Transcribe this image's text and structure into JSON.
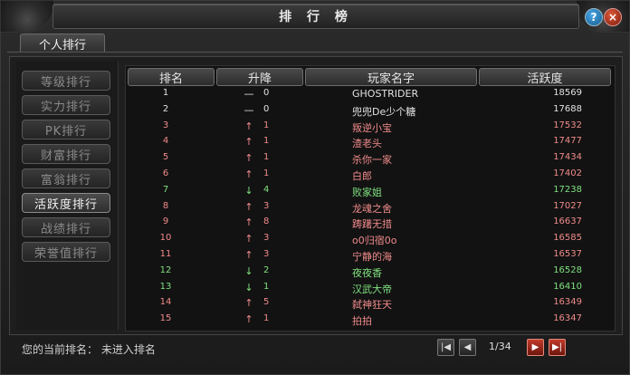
{
  "window": {
    "title": "排 行 榜"
  },
  "controls": {
    "help": "?",
    "close": "×"
  },
  "tab": {
    "label": "个人排行"
  },
  "sidebar": {
    "items": [
      {
        "label": "等级排行",
        "active": false
      },
      {
        "label": "实力排行",
        "active": false
      },
      {
        "label": "PK排行",
        "active": false
      },
      {
        "label": "财富排行",
        "active": false
      },
      {
        "label": "富翁排行",
        "active": false
      },
      {
        "label": "活跃度排行",
        "active": true
      },
      {
        "label": "战绩排行",
        "active": false
      },
      {
        "label": "荣誉值排行",
        "active": false
      }
    ]
  },
  "table": {
    "headers": [
      "排名",
      "升降",
      "玩家名字",
      "活跃度"
    ],
    "rows": [
      {
        "rank": "1",
        "dir": "—",
        "change": "0",
        "name": "GHOSTRIDER",
        "score": "18569",
        "color": "white"
      },
      {
        "rank": "2",
        "dir": "—",
        "change": "0",
        "name": "兜兜De少个糖",
        "score": "17688",
        "color": "white"
      },
      {
        "rank": "3",
        "dir": "↑",
        "change": "1",
        "name": "叛逆小宝",
        "score": "17532",
        "color": "red"
      },
      {
        "rank": "4",
        "dir": "↑",
        "change": "1",
        "name": "渣老头",
        "score": "17477",
        "color": "red"
      },
      {
        "rank": "5",
        "dir": "↑",
        "change": "1",
        "name": "杀你一家",
        "score": "17434",
        "color": "red"
      },
      {
        "rank": "6",
        "dir": "↑",
        "change": "1",
        "name": "白郎",
        "score": "17402",
        "color": "red"
      },
      {
        "rank": "7",
        "dir": "↓",
        "change": "4",
        "name": "败家姐",
        "score": "17238",
        "color": "green"
      },
      {
        "rank": "8",
        "dir": "↑",
        "change": "3",
        "name": "龙魂之舍",
        "score": "17027",
        "color": "red"
      },
      {
        "rank": "9",
        "dir": "↑",
        "change": "8",
        "name": "踌躇无措",
        "score": "16637",
        "color": "red"
      },
      {
        "rank": "10",
        "dir": "↑",
        "change": "3",
        "name": "o0归宿0o",
        "score": "16585",
        "color": "red"
      },
      {
        "rank": "11",
        "dir": "↑",
        "change": "3",
        "name": "宁静的海",
        "score": "16537",
        "color": "red"
      },
      {
        "rank": "12",
        "dir": "↓",
        "change": "2",
        "name": "夜夜香",
        "score": "16528",
        "color": "green"
      },
      {
        "rank": "13",
        "dir": "↓",
        "change": "1",
        "name": "汉武大帝",
        "score": "16410",
        "color": "green"
      },
      {
        "rank": "14",
        "dir": "↑",
        "change": "5",
        "name": "弑神狂天",
        "score": "16349",
        "color": "red"
      },
      {
        "rank": "15",
        "dir": "↑",
        "change": "1",
        "name": "拍拍",
        "score": "16347",
        "color": "red"
      }
    ]
  },
  "footer": {
    "label": "您的当前排名：  未进入排名",
    "page": "1/34",
    "first": "|◀",
    "prev": "◀",
    "next": "▶",
    "last": "▶|"
  },
  "colors": {
    "up": "#f08a8a",
    "down": "#7fe07f",
    "neutral": "#e2e2e2"
  }
}
